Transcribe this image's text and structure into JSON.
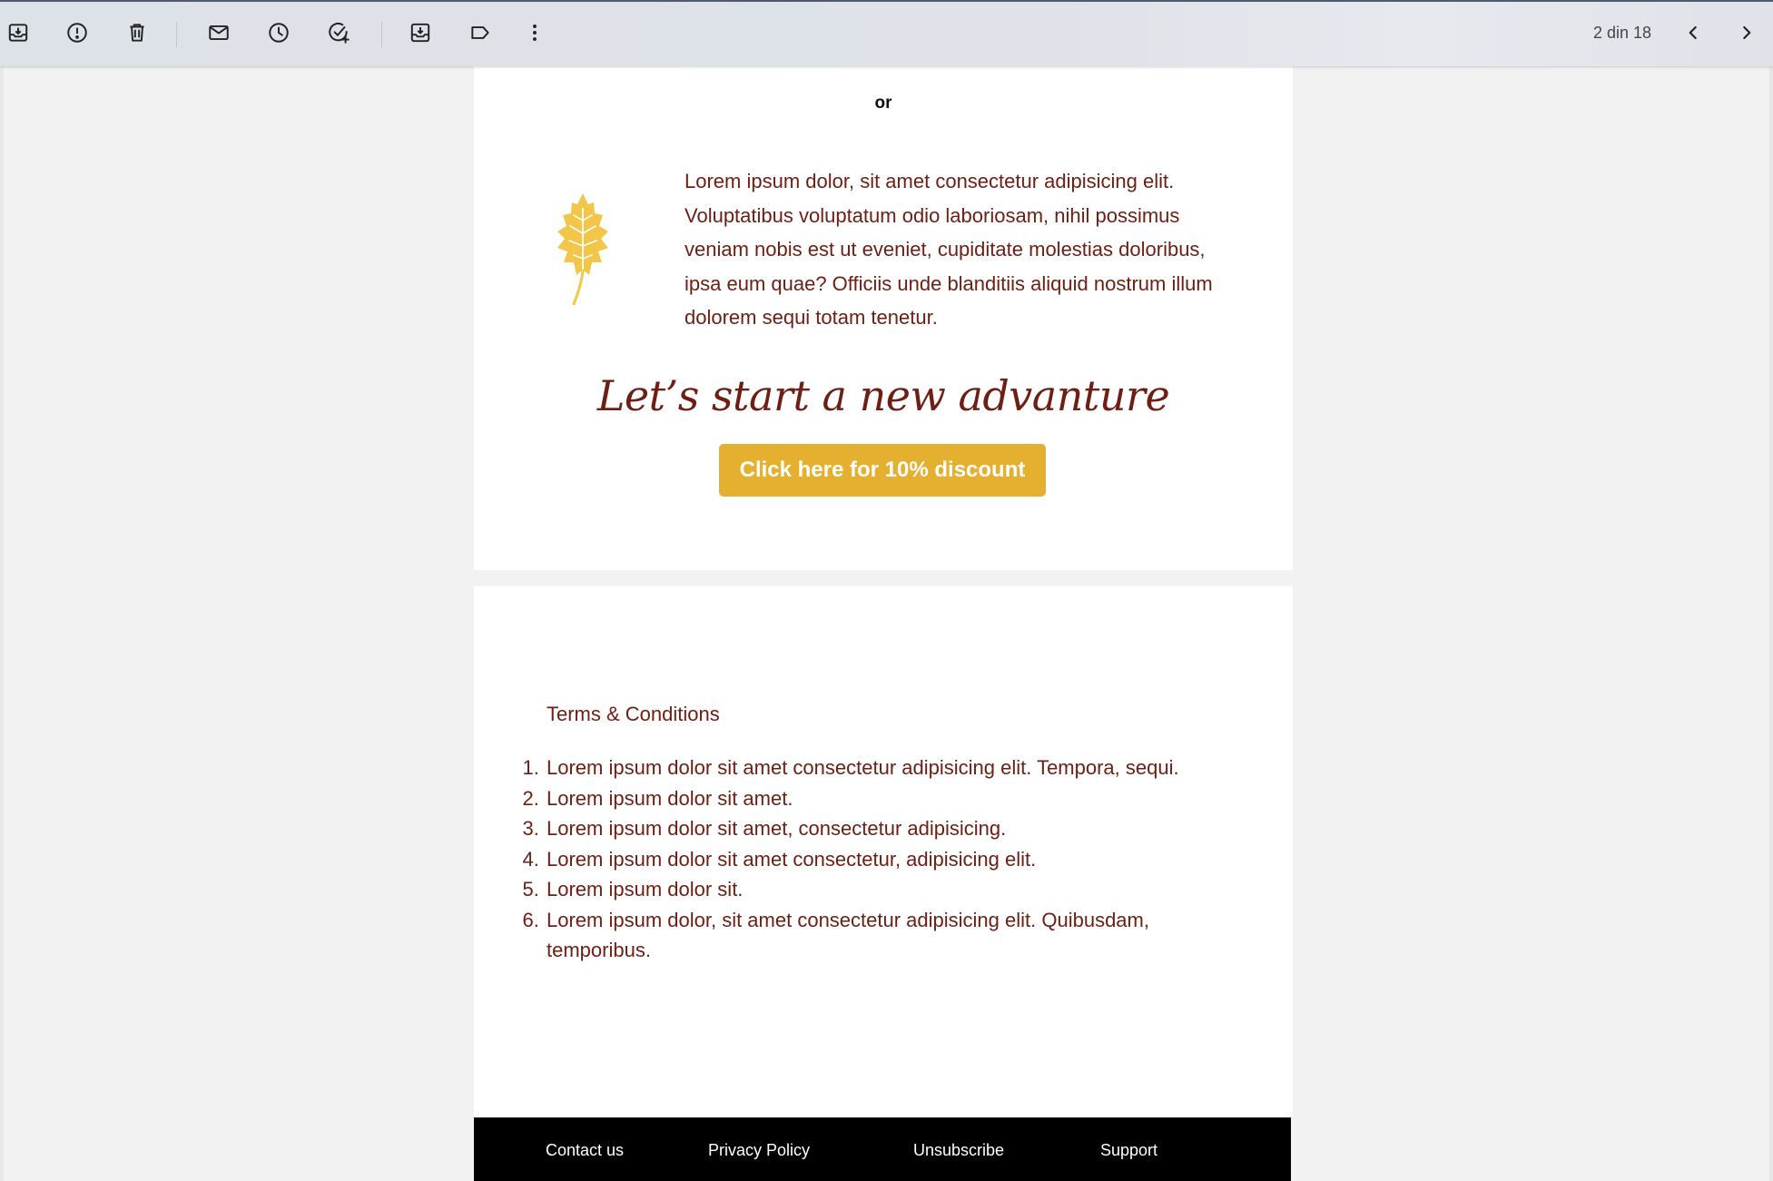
{
  "toolbar": {
    "icons": [
      "archive-icon",
      "report-spam-icon",
      "delete-icon",
      "mark-unread-icon",
      "snooze-icon",
      "add-task-icon",
      "move-to-icon",
      "label-icon",
      "more-options-icon"
    ],
    "pager_text": "2 din 18"
  },
  "email": {
    "or_text": "or",
    "intro_text": "Lorem ipsum dolor, sit amet consectetur adipisicing elit. Voluptatibus voluptatum odio laboriosam, nihil possimus veniam nobis est ut eveniet, cupiditate molestias doloribus, ipsa eum quae? Officiis unde blanditiis aliquid nostrum illum dolorem sequi totam tenetur.",
    "headline": "Let’s start a new advanture",
    "cta_label": "Click here for 10% discount",
    "terms_title": "Terms & Conditions",
    "terms": [
      "Lorem ipsum dolor sit amet consectetur adipisicing elit. Tempora, sequi.",
      "Lorem ipsum dolor sit amet.",
      "Lorem ipsum dolor sit amet, consectetur adipisicing.",
      "Lorem ipsum dolor sit amet consectetur, adipisicing elit.",
      "Lorem ipsum dolor sit.",
      "Lorem ipsum dolor, sit amet consectetur adipisicing elit. Quibusdam, temporibus."
    ],
    "footer_links": [
      "Contact us",
      "Privacy Policy",
      "Unsubscribe",
      "Support"
    ]
  },
  "colors": {
    "text_brown": "#6e1e12",
    "cta_gold": "#e5b02f",
    "leaf_yellow": "#f3c64a",
    "page_bg": "#f3f2f2"
  }
}
